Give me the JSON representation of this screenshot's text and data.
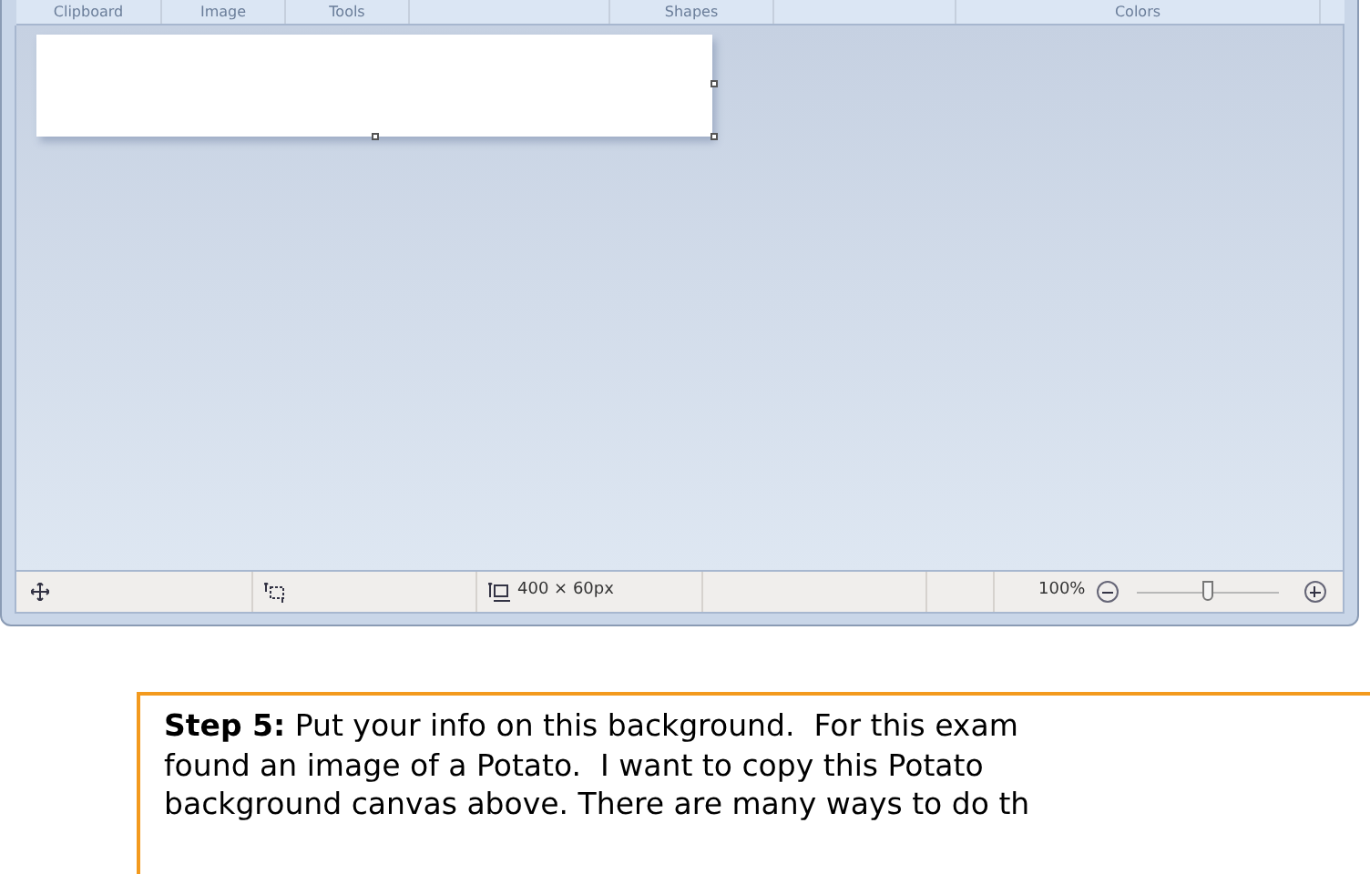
{
  "ribbon": {
    "groups": [
      "Clipboard",
      "Image",
      "Tools",
      "Shapes",
      "Colors"
    ]
  },
  "status_bar": {
    "size": "400 × 60px",
    "zoom": "100%",
    "zoom_slider": {
      "level": 0.5
    }
  },
  "callout": {
    "lines": [
      "**Step 5:** Put your info on this background.  For this exam",
      "found an image of a Potato.  I want to copy this Potato",
      "background canvas above. There are many ways to do th"
    ]
  }
}
